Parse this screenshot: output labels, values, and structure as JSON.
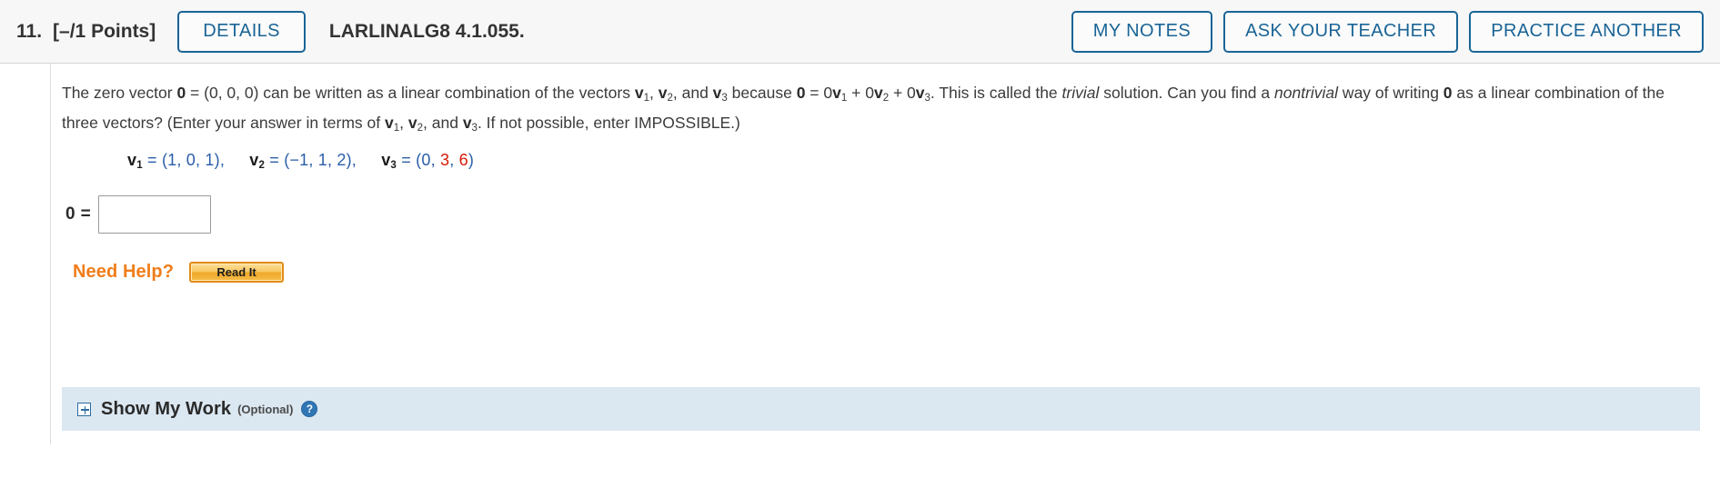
{
  "header": {
    "question_number": "11.",
    "points": "[–/1 Points]",
    "details_label": "DETAILS",
    "question_code": "LARLINALG8 4.1.055.",
    "buttons": [
      {
        "label": "MY NOTES",
        "name": "my-notes-button"
      },
      {
        "label": "ASK YOUR TEACHER",
        "name": "ask-your-teacher-button"
      },
      {
        "label": "PRACTICE ANOTHER",
        "name": "practice-another-button"
      }
    ]
  },
  "problem": {
    "line1_a": "The zero vector ",
    "zero_bold": "0",
    "line1_b": " = (0, 0, 0) can be written as a linear combination of the vectors ",
    "v_label": "v",
    "line1_c": ", and ",
    "line1_d": " because ",
    "line1_e": " = 0",
    "line1_f": " + 0",
    "line1_g": " + 0",
    "line1_h": ". This is called the ",
    "trivial": "trivial",
    "line1_i": " solution. Can you find a",
    "nontrivial": "nontrivial",
    "line2_a": " way of writing ",
    "line2_b": " as a linear combination of the three vectors? (Enter your answer in terms of ",
    "line2_c": ", and ",
    "line2_d": ". If not possible, enter IMPOSSIBLE.)"
  },
  "vectors": {
    "v1": {
      "name": "v",
      "sub": "1",
      "eq": "=",
      "open": "(",
      "comps": [
        "1",
        "0",
        "1"
      ],
      "close": "),"
    },
    "v2": {
      "name": "v",
      "sub": "2",
      "eq": "=",
      "open": "(",
      "comps": [
        "−1",
        "1",
        "2"
      ],
      "close": "),"
    },
    "v3": {
      "name": "v",
      "sub": "3",
      "eq": "=",
      "open": "(",
      "comps": [
        "0",
        "3",
        "6"
      ],
      "close": ")"
    },
    "red_components": [
      "3",
      "6"
    ],
    "blue_color": "#2b5ea8",
    "red_color": "#d81b09"
  },
  "answer": {
    "label": "0",
    "equals": "=",
    "value": "",
    "placeholder": ""
  },
  "help": {
    "need_help_label": "Need Help?",
    "read_it_label": "Read It",
    "accent_color": "#f07d1a"
  },
  "show_my_work": {
    "expand_icon": "plus-box-icon",
    "title": "Show My Work",
    "optional": "(Optional)",
    "help_icon_label": "?",
    "background_color": "#dbe7f1"
  }
}
